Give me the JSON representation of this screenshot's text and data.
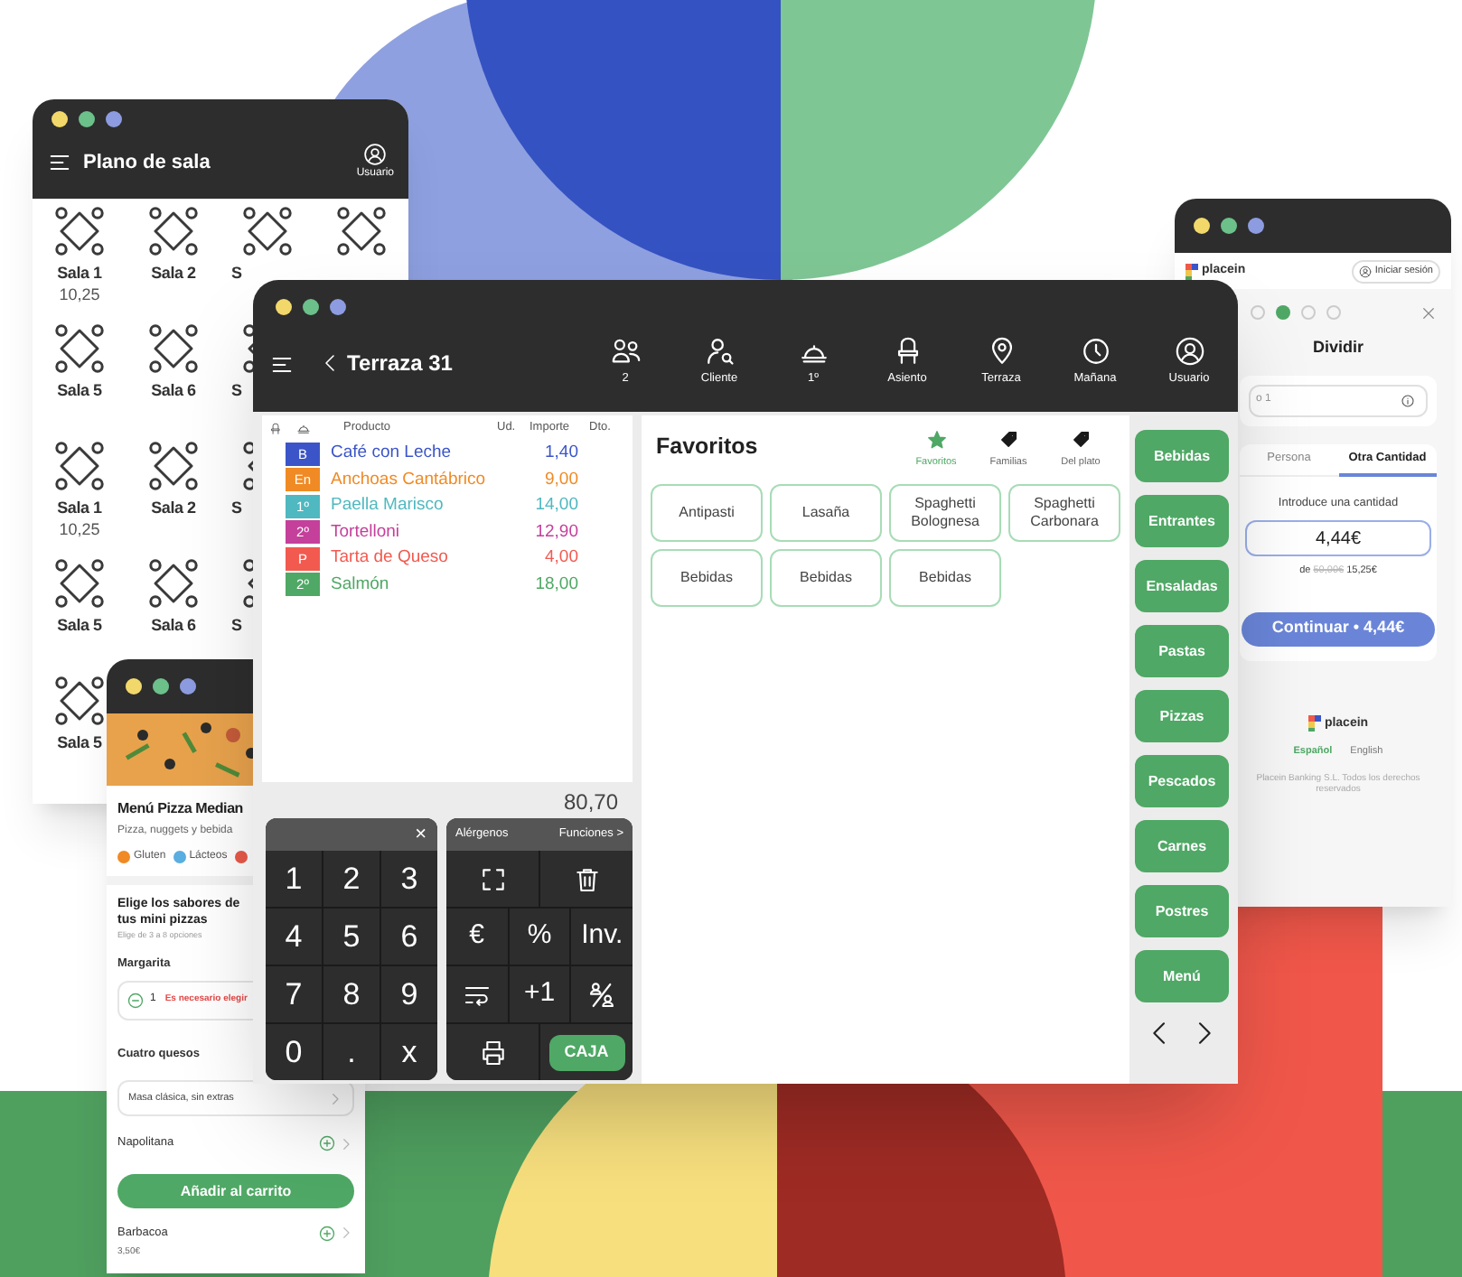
{
  "floor_plan_window": {
    "title": "Plano de sala",
    "user_label": "Usuario",
    "rows": [
      {
        "tables": [
          {
            "kind": "table",
            "label": "Sala 1",
            "amount": "10,25"
          },
          {
            "kind": "table",
            "label": "Sala 2"
          },
          {
            "kind": "table",
            "label": "S"
          },
          {
            "kind": "table"
          }
        ]
      },
      {
        "tables": [
          {
            "kind": "table",
            "label": "Sala 5"
          },
          {
            "kind": "table",
            "label": "Sala 6"
          },
          {
            "kind": "table",
            "label": "S"
          }
        ]
      },
      {
        "tables": [
          {
            "kind": "table",
            "label": "Sala 1",
            "amount": "10,25"
          },
          {
            "kind": "table",
            "label": "Sala 2"
          },
          {
            "kind": "table",
            "label": "S"
          }
        ]
      },
      {
        "tables": [
          {
            "kind": "table",
            "label": "Sala 5"
          },
          {
            "kind": "table",
            "label": "Sala 6"
          },
          {
            "kind": "table",
            "label": "S"
          }
        ]
      },
      {
        "tables": [
          {
            "kind": "table",
            "label": "Sala 5"
          }
        ]
      }
    ]
  },
  "main_window": {
    "title": "Terraza 31",
    "toolbar": [
      {
        "kind": "guests",
        "label": "2"
      },
      {
        "kind": "client",
        "label": "Cliente"
      },
      {
        "kind": "course",
        "label": "1º"
      },
      {
        "kind": "seat",
        "label": "Asiento"
      },
      {
        "kind": "zone",
        "label": "Terraza"
      },
      {
        "kind": "time",
        "label": "Mañana"
      },
      {
        "kind": "user",
        "label": "Usuario"
      }
    ],
    "ticket": {
      "columns": [
        "Producto",
        "Ud.",
        "Importe",
        "Dto."
      ],
      "lines": [
        {
          "badge": "B",
          "name": "Café con Leche",
          "amount": "1,40",
          "color": "#3b55c8"
        },
        {
          "badge": "En",
          "name": "Anchoas Cantábrico",
          "amount": "9,00",
          "color": "#f08a24"
        },
        {
          "badge": "1º",
          "name": "Paella Marisco",
          "amount": "14,00",
          "color": "#4fb8c0"
        },
        {
          "badge": "2º",
          "name": "Tortelloni",
          "amount": "12,90",
          "color": "#c4409a"
        },
        {
          "badge": "P",
          "name": "Tarta de Queso",
          "amount": "4,00",
          "color": "#f25a50"
        },
        {
          "badge": "2º",
          "name": "Salmón",
          "amount": "18,00",
          "color": "#4fa865"
        }
      ],
      "total": "80,70"
    },
    "keypad": {
      "close": "×",
      "keys": [
        "1",
        "2",
        "3",
        "4",
        "5",
        "6",
        "7",
        "8",
        "9",
        "0",
        ".",
        "x"
      ]
    },
    "function_pad": {
      "header_buttons": [
        "Alérgenos",
        "Funciones >"
      ],
      "keys": [
        {
          "kind": "fullscreen"
        },
        {
          "kind": "trash"
        },
        {
          "kind": "text",
          "label": "€"
        },
        {
          "kind": "text",
          "label": "%"
        },
        {
          "kind": "text",
          "label": "Inv."
        },
        {
          "kind": "wrap"
        },
        {
          "kind": "text",
          "label": "+1"
        },
        {
          "kind": "split"
        },
        {
          "kind": "printer"
        },
        {
          "kind": "cash",
          "label": "CAJA"
        }
      ]
    },
    "favorites": {
      "title": "Favoritos",
      "tabs": [
        {
          "kind": "star",
          "label": "Favoritos",
          "selected": true
        },
        {
          "kind": "tag",
          "label": "Familias",
          "selected": false
        },
        {
          "kind": "tag",
          "label": "Del plato",
          "selected": false
        }
      ],
      "products": [
        "Antipasti",
        "Lasaña",
        "Spaghetti Bolognesa",
        "Spaghetti Carbonara",
        "Bebidas",
        "Bebidas",
        "Bebidas"
      ]
    },
    "categories": [
      "Bebidas",
      "Entrantes",
      "Ensaladas",
      "Pastas",
      "Pizzas",
      "Pescados",
      "Carnes",
      "Postres",
      "Menú"
    ]
  },
  "split_window": {
    "brand": "placein",
    "login": "Iniciar sesión",
    "steps": [
      {
        "selected": false
      },
      {
        "selected": true
      },
      {
        "selected": false
      },
      {
        "selected": false
      }
    ],
    "title": "Dividir",
    "name_placeholder": "o 1",
    "tabs": [
      {
        "label": "Persona",
        "selected": false
      },
      {
        "label": "Otra Cantidad",
        "selected": true
      }
    ],
    "prompt": "Introduce una cantidad",
    "amount": "4,44€",
    "of_label": "de",
    "original_total": "50,00€",
    "remaining": "15,25€",
    "continue_button": "Continuar • 4,44€",
    "footer_brand": "placein",
    "languages": [
      {
        "label": "Español",
        "selected": true
      },
      {
        "label": "English",
        "selected": false
      }
    ],
    "copyright": "Placein Banking S.L. Todos los derechos reservados"
  },
  "pizza_window": {
    "title": "Menú Pizza Median",
    "subtitle": "Pizza, nuggets y bebida",
    "allergens": [
      {
        "label": "Gluten",
        "color": "#f08a24"
      },
      {
        "label": "Lácteos",
        "color": "#5aaee0"
      },
      {
        "color": "#e85a4a"
      }
    ],
    "section_title": "Elige los sabores de tus mini pizzas",
    "section_hint": "Elige de 3 a 8 opciones",
    "options": [
      {
        "kind": "stepper",
        "name": "Margarita",
        "quantity": "1",
        "warning": "Es necesario elegir"
      },
      {
        "kind": "select",
        "name": "Cuatro quesos",
        "choice": "Masa clásica, sin extras"
      },
      {
        "kind": "add",
        "name": "Napolitana"
      }
    ],
    "cart_button": "Añadir al carrito",
    "after_button": [
      {
        "kind": "add",
        "name": "Barbacoa",
        "price": "3,50€"
      }
    ]
  }
}
